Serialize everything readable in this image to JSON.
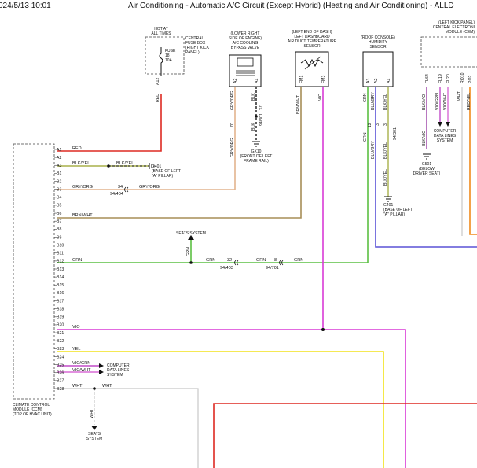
{
  "header": {
    "timestamp": "024/5/13 10:01",
    "title": "Air Conditioning - Automatic A/C Circuit (Except Hybrid) (Heating and Air Conditioning) - ALLD"
  },
  "components": {
    "fuse_box": {
      "lines": [
        "HOT AT",
        "ALL TIMES"
      ],
      "desc": [
        "CENTRAL",
        "FUSE BOX",
        "(RIGHT KICK",
        "PANEL)"
      ],
      "fuse": [
        "FUSE",
        "18",
        "10A"
      ],
      "pin": "A12",
      "wire": "RED"
    },
    "bypass_valve": {
      "desc": [
        "(LOWER RIGHT",
        "SIDE OF ENGINE)",
        "A/C COOLING",
        "BYPASS VALVE"
      ],
      "pins": [
        "A2",
        "A1"
      ],
      "wires": [
        "GRY/ORG",
        "BLK"
      ],
      "conn": "X/1",
      "conn_id": "94/301"
    },
    "duct_sensor": {
      "desc": [
        "(LEFT END OF DASH)",
        "LEFT DASHBOARD",
        "AIR DUCT TEMPERATURE",
        "SENSOR"
      ],
      "pins": [
        "FM1",
        "FM3"
      ],
      "wires": [
        "BRN/WHT",
        "VIO"
      ]
    },
    "humidity_sensor": {
      "desc": [
        "(ROOF CONSOLE)",
        "HUMIDITY",
        "SENSOR"
      ],
      "pins": [
        "A3",
        "A2",
        "A1"
      ],
      "wires": [
        "GRN",
        "BLU/GRY",
        "BLK/YEL"
      ],
      "mid_pins": [
        "12",
        "3",
        "3"
      ],
      "conn_id": "94/301"
    },
    "cem": {
      "desc": [
        "(LEFT KICK PANEL)",
        "CENTRAL ELECTRONI",
        "MODULE (CEM)"
      ],
      "pins": [
        "FL64",
        "FL19",
        "FL20",
        "RO10",
        "PO2"
      ],
      "wires": [
        "BLK/VIO",
        "VIO/GRN",
        "VIO/WHT",
        "WHT",
        "RED/YEL"
      ]
    },
    "ccm": {
      "desc": [
        "CLIMATE CONTROL",
        "MODULE (CCM)",
        "(TOP OF HVAC UNIT)"
      ]
    },
    "gx10": {
      "desc": [
        "GX10",
        "(FRONT OF LEFT",
        "FRAME RAIL)"
      ]
    },
    "g401_a": {
      "desc": [
        "G401",
        "(BASE OF LEFT",
        "\"A\" PILLAR)"
      ]
    },
    "g401_b": {
      "desc": [
        "G401",
        "(BASE OF LEFT",
        "\"A\" PILLAR)"
      ]
    },
    "g501": {
      "desc": [
        "G501",
        "(BELOW",
        "DRIVER SEAT)"
      ]
    },
    "seats_top": {
      "desc": [
        "SEATS SYSTEM"
      ]
    },
    "seats_bottom": {
      "desc": [
        "SEATS",
        "SYSTEM"
      ]
    },
    "data_lines_ccm": {
      "desc": [
        "COMPUTER",
        "DATA LINES",
        "SYSTEM"
      ]
    },
    "data_lines_cem": {
      "desc": [
        "COMPUTER",
        "DATA LINES",
        "SYSTEM"
      ]
    }
  },
  "ccm_pins": [
    "A1",
    "A2",
    "A3",
    "B1",
    "B2",
    "B3",
    "B4",
    "B5",
    "B6",
    "B7",
    "B8",
    "B9",
    "B10",
    "B11",
    "B12",
    "B13",
    "B14",
    "B15",
    "B16",
    "B17",
    "B18",
    "B19",
    "B20",
    "B21",
    "B22",
    "B23",
    "B24",
    "B25",
    "B26",
    "B27",
    "B28"
  ],
  "wire_labels": {
    "a1": "RED",
    "a3": "BLK/YEL",
    "a3_mid": "BLK/YEL",
    "b1": "GRY/ORG",
    "b1_mid": "GRY/ORG",
    "b1_pin": "34",
    "b1_conn": "94/404",
    "b5": "BRN/WHT",
    "b11": "GRN",
    "b11_mid1": "GRN",
    "b11_pin1": "32",
    "b11_conn1": "94/403",
    "b11_mid2": "GRN",
    "b11_pin2": "8",
    "b11_conn2": "94/701",
    "b11_right": "GRN",
    "seats_v": "GRN",
    "b20": "VIO",
    "b23": "YEL",
    "b25": "VIO/GRN",
    "b26": "VIO/WHT",
    "b28": "WHT",
    "b28_mid": "WHT",
    "seats_wire_v": "WHT",
    "blk_below": "BLK",
    "blk_yel_below": "BLK/YEL",
    "blu_gry_below": "BLU/GRY",
    "grn_v": "GRN",
    "gry_org_v": "GRY/ORG",
    "bypass_pin": "70",
    "blk_vio_below": "BLK/VIO"
  },
  "colors": {
    "red": "#dd2a22",
    "grn": "#5cc043",
    "vio": "#d93ad6",
    "yel": "#f2e21a",
    "brnwht": "#a78d56",
    "gryorg": "#e2b48e",
    "blk": "#1a1a1a",
    "blu": "#5a52d6",
    "orange": "#f08a1c",
    "wht": "#c8c8c8",
    "olive": "#a9b14a"
  }
}
